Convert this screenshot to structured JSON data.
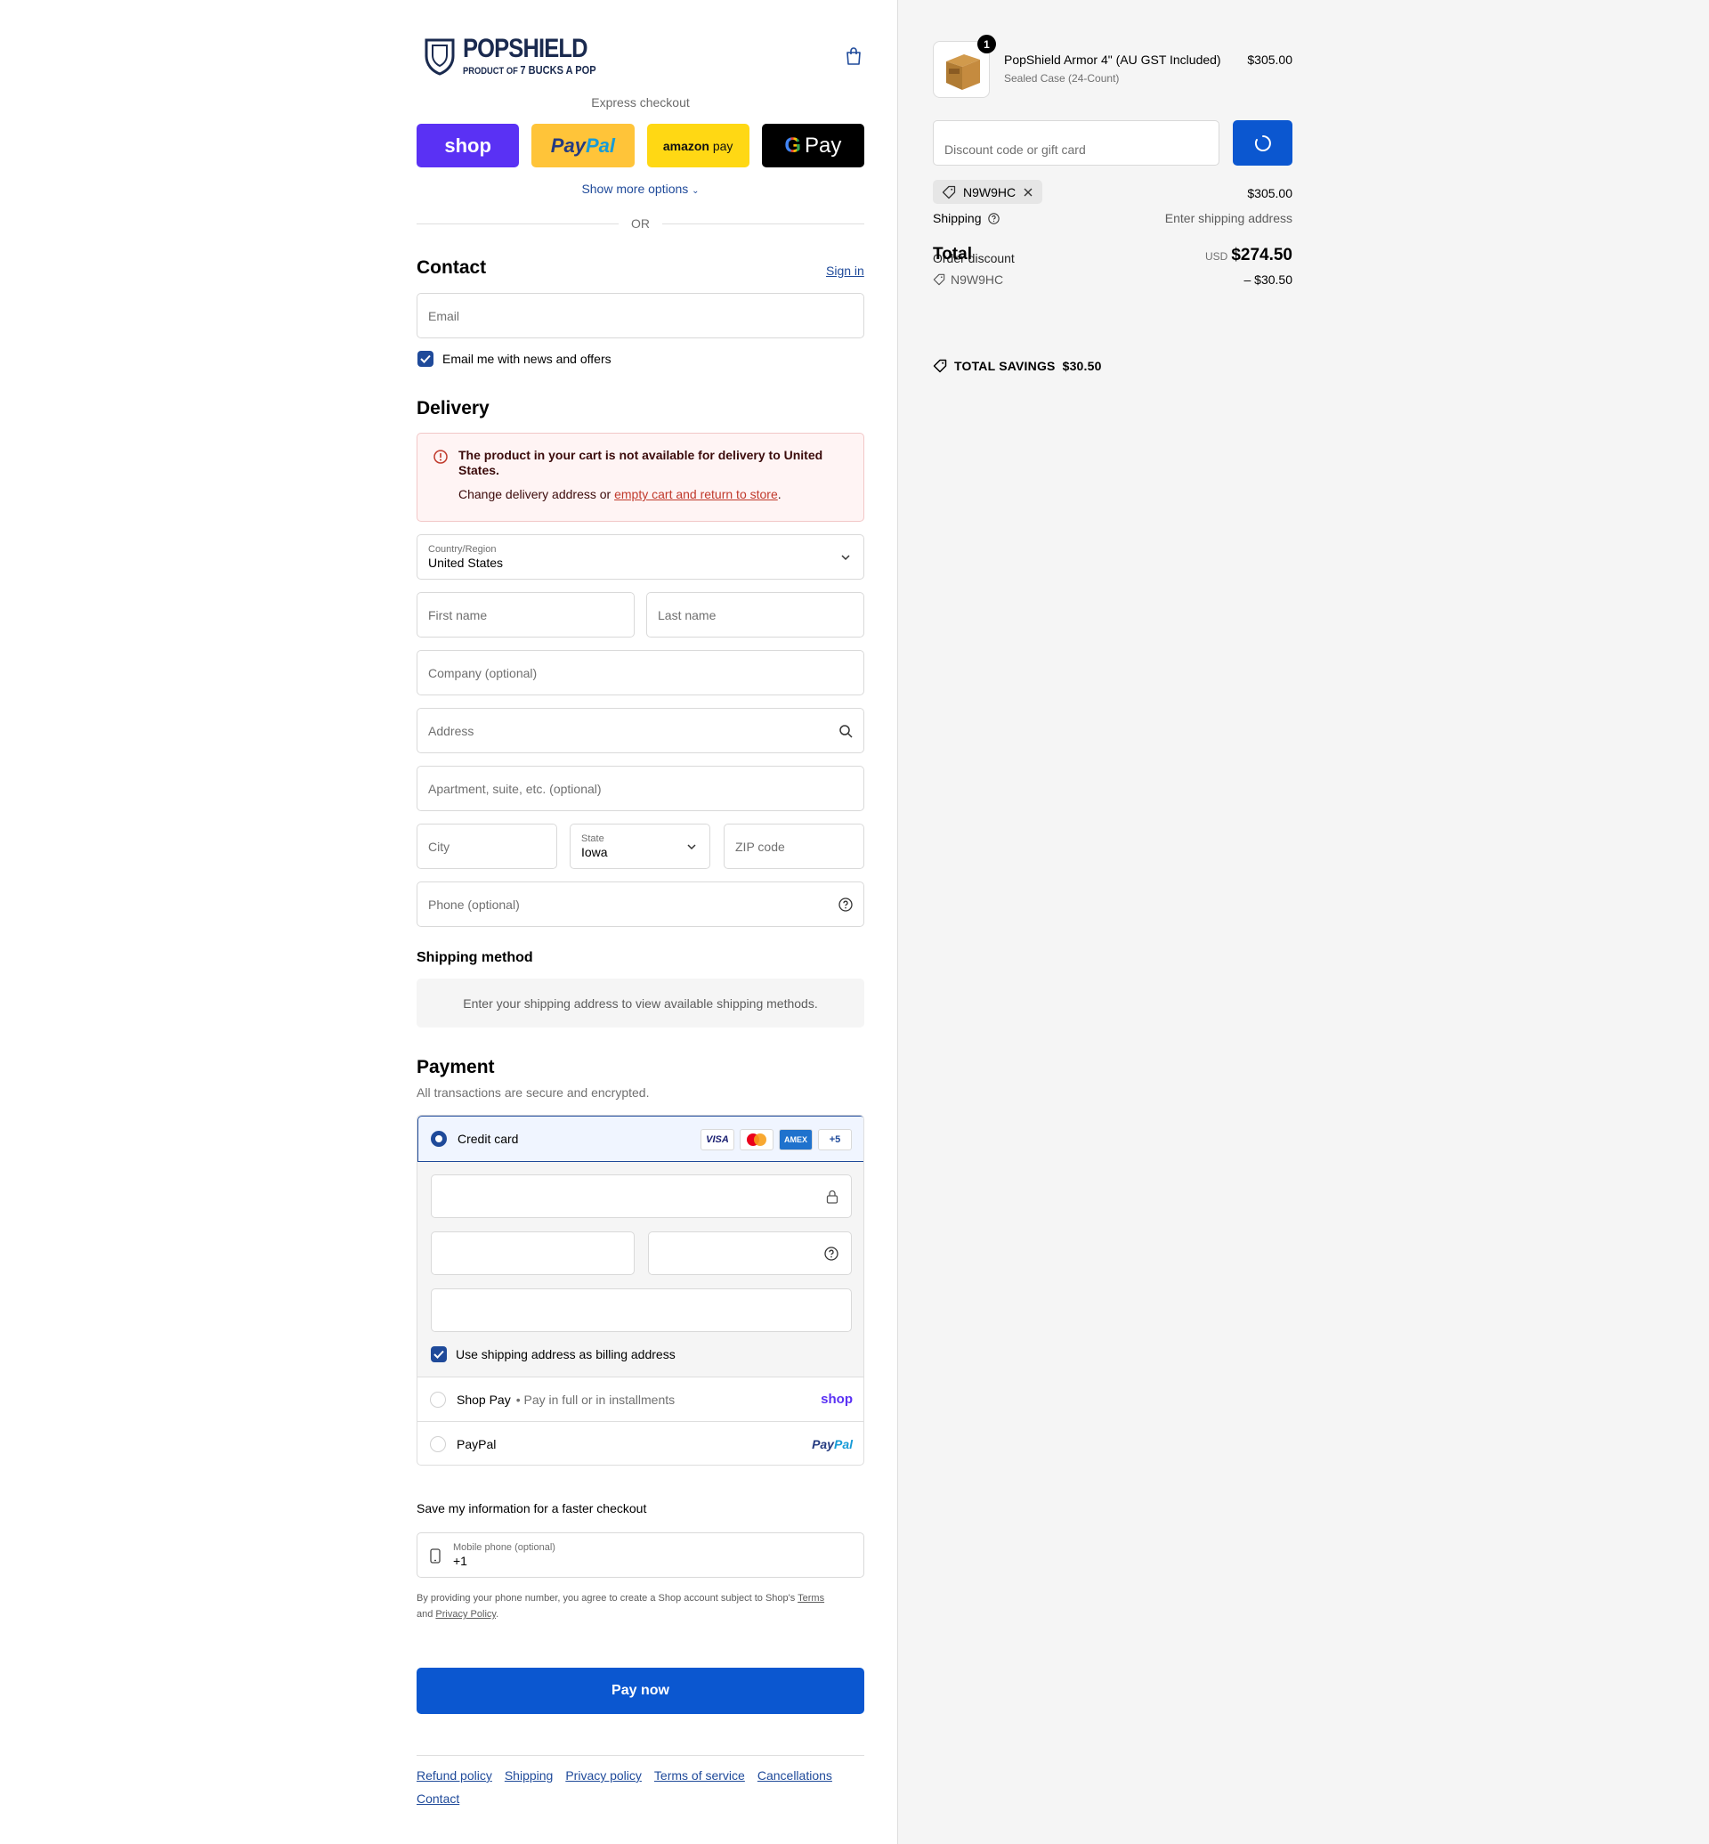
{
  "brand": {
    "name": "POPSHIELD",
    "tagline_prefix": "PRODUCT OF",
    "tagline": "7 BUCKS A POP"
  },
  "express": {
    "title": "Express checkout",
    "shop": "shop",
    "paypal_a": "Pay",
    "paypal_b": "Pal",
    "amazon_a": "amazon",
    "amazon_b": "pay",
    "gpay": "Pay",
    "show_more": "Show more options",
    "or": "OR"
  },
  "contact": {
    "heading": "Contact",
    "sign_in": "Sign in",
    "email_placeholder": "Email",
    "news_label": "Email me with news and offers"
  },
  "delivery": {
    "heading": "Delivery",
    "alert_title": "The product in your cart is not available for delivery to United States.",
    "alert_text": "Change delivery address or",
    "alert_link": "empty cart and return to store",
    "alert_tail": ".",
    "country_label": "Country/Region",
    "country_value": "United States",
    "first_name": "First name",
    "last_name": "Last name",
    "company": "Company (optional)",
    "address": "Address",
    "apartment": "Apartment, suite, etc. (optional)",
    "city": "City",
    "state_label": "State",
    "state_value": "Iowa",
    "zip": "ZIP code",
    "phone": "Phone (optional)"
  },
  "shipping_method": {
    "heading": "Shipping method",
    "note": "Enter your shipping address to view available shipping methods."
  },
  "payment": {
    "heading": "Payment",
    "sub": "All transactions are secure and encrypted.",
    "credit_card": "Credit card",
    "cards": [
      "VISA",
      "",
      "AMEX",
      "+5"
    ],
    "billing_same": "Use shipping address as billing address",
    "shop_pay": "Shop Pay",
    "shop_pay_sub": "• Pay in full or in installments",
    "shop_pay_logo": "shop",
    "paypal": "PayPal",
    "paypal_logo_a": "Pay",
    "paypal_logo_b": "Pal"
  },
  "save": {
    "title": "Save my information for a faster checkout",
    "mobile_label": "Mobile phone (optional)",
    "mobile_value": "+1",
    "terms_a": "By providing your phone number, you agree to create a Shop account subject to Shop's",
    "terms_link1": "Terms",
    "terms_b": "and",
    "terms_link2": "Privacy Policy",
    "terms_c": "."
  },
  "pay_now": "Pay now",
  "footer_links": [
    "Refund policy",
    "Shipping",
    "Privacy policy",
    "Terms of service",
    "Cancellations",
    "Contact"
  ],
  "summary": {
    "product_name": "PopShield Armor 4\" (AU GST Included)",
    "product_variant": "Sealed Case (24-Count)",
    "product_price": "$305.00",
    "quantity": "1",
    "discount_placeholder": "Discount code or gift card",
    "code": "N9W9HC",
    "subtotal_value": "$305.00",
    "shipping_label": "Shipping",
    "shipping_value": "Enter shipping address",
    "total_label": "Total",
    "order_discount_label": "Order discount",
    "currency": "USD",
    "total_value": "$274.50",
    "discount_code": "N9W9HC",
    "discount_value": "– $30.50",
    "savings_label": "TOTAL SAVINGS",
    "savings_value": "$30.50"
  },
  "colors": {
    "primary": "#0b57d0",
    "link": "#1f4a9a",
    "shop": "#5a31f4",
    "paypal": "#ffc439",
    "amazon": "#ffd814"
  }
}
